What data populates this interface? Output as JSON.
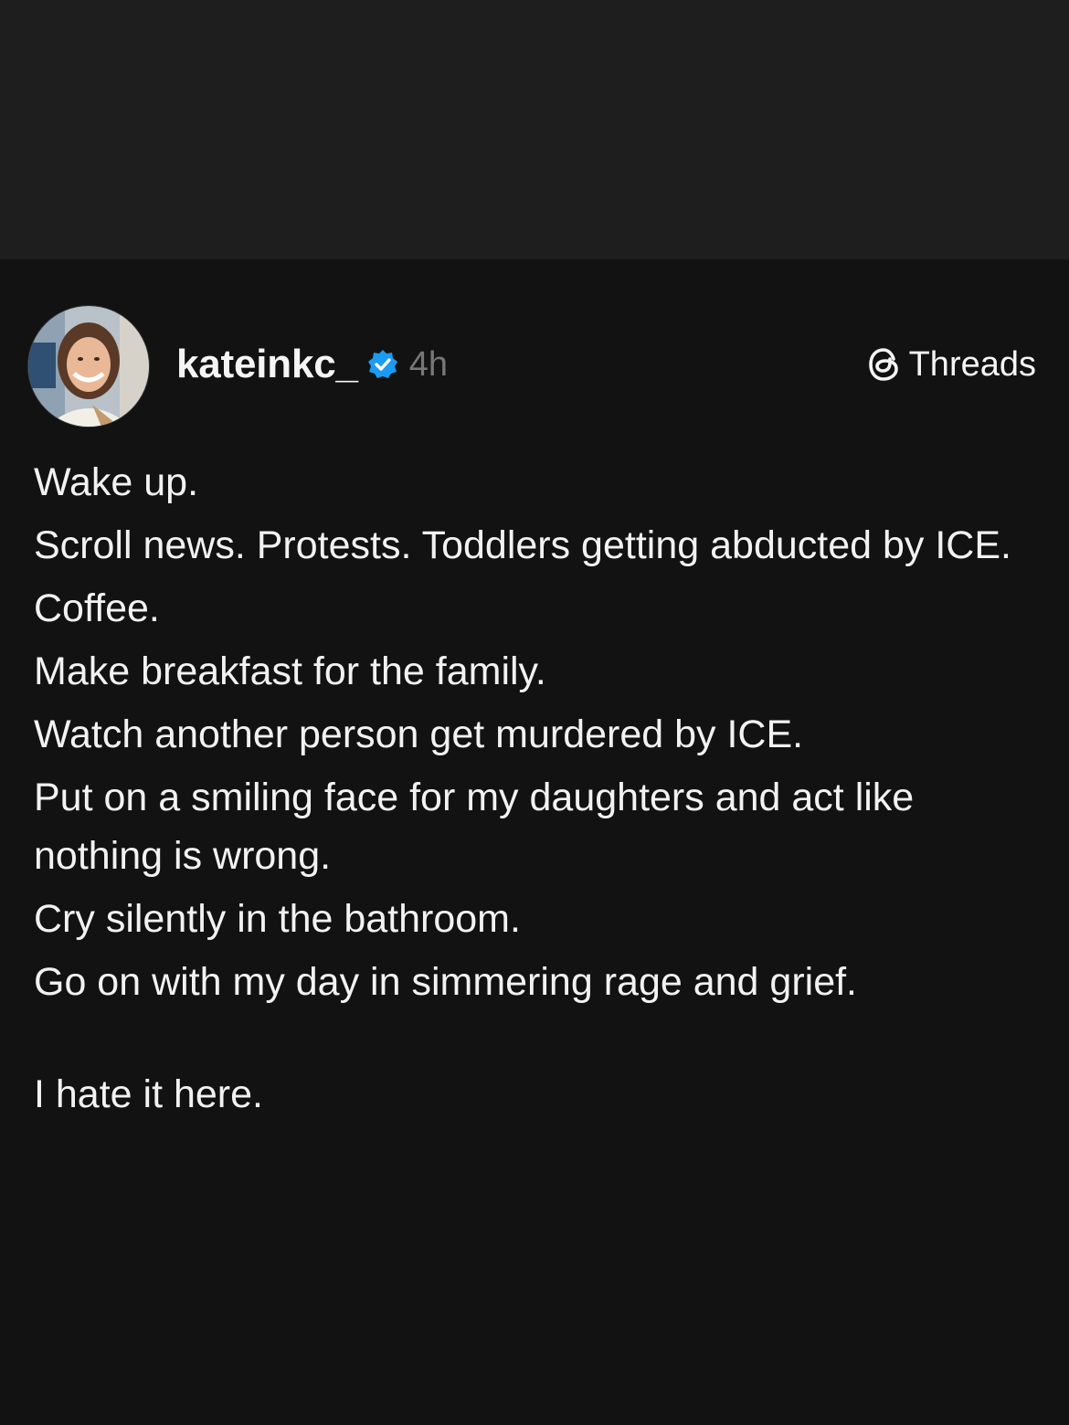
{
  "post": {
    "username": "kateinkc_",
    "timestamp": "4h",
    "brand_label": "Threads",
    "icons": {
      "verified": "verified-badge-icon",
      "brand": "threads-logo-icon"
    },
    "lines": [
      "Wake up.",
      "Scroll news. Protests. Toddlers getting abducted by ICE.",
      "Coffee.",
      "Make breakfast for the family.",
      "Watch another person get murdered by ICE.",
      "Put on a smiling face for my daughters and act like nothing is wrong.",
      "Cry silently in the bathroom.",
      "Go on with my day in simmering rage and grief."
    ],
    "closing": "I hate it here."
  },
  "colors": {
    "background": "#121212",
    "top_band": "#1e1e1e",
    "text": "#f2f2f2",
    "muted": "#777777",
    "verified_blue": "#1d9bf0"
  }
}
